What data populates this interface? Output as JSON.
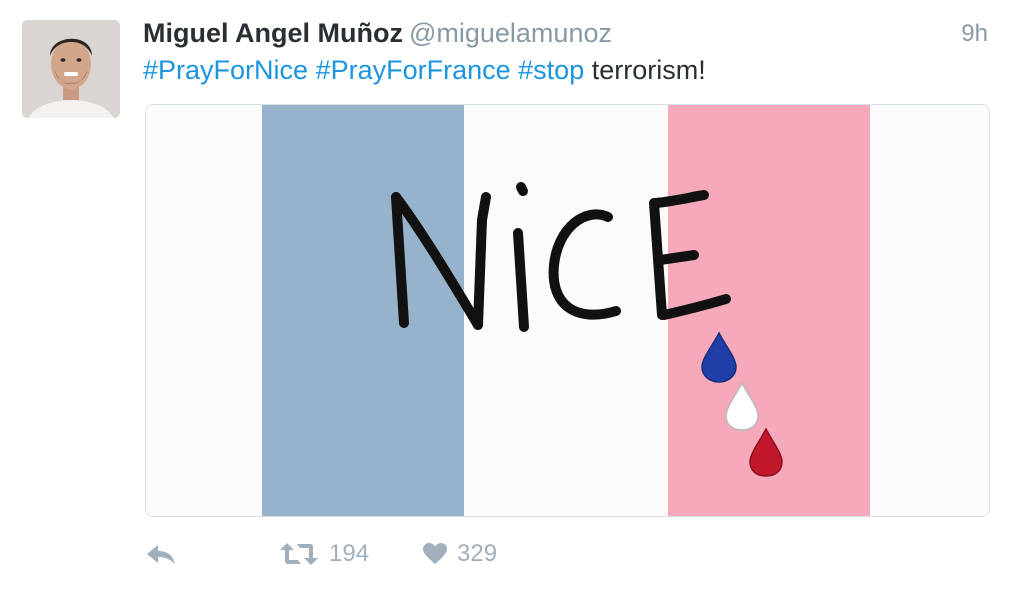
{
  "tweet": {
    "author_name": "Miguel Angel Muñoz",
    "handle": "@miguelamunoz",
    "time": "9h",
    "text": {
      "hashtags": [
        "#PrayForNice",
        "#PrayForFrance",
        "#stop"
      ],
      "tail": "terrorism!"
    },
    "media": {
      "drawn_word": "NiCE",
      "stripe_colors": [
        "#97b3cb",
        "#fbfbfb",
        "#f5a9bb"
      ],
      "teardrop_colors": [
        "#1f3ea8",
        "#ffffff",
        "#c2182b"
      ]
    },
    "actions": {
      "reply_icon": "reply-icon",
      "retweet_icon": "retweet-icon",
      "retweet_count": "194",
      "like_icon": "heart-icon",
      "like_count": "329"
    }
  },
  "colors": {
    "link": "#1b95e0",
    "text": "#292f33",
    "muted": "#8899a6"
  }
}
